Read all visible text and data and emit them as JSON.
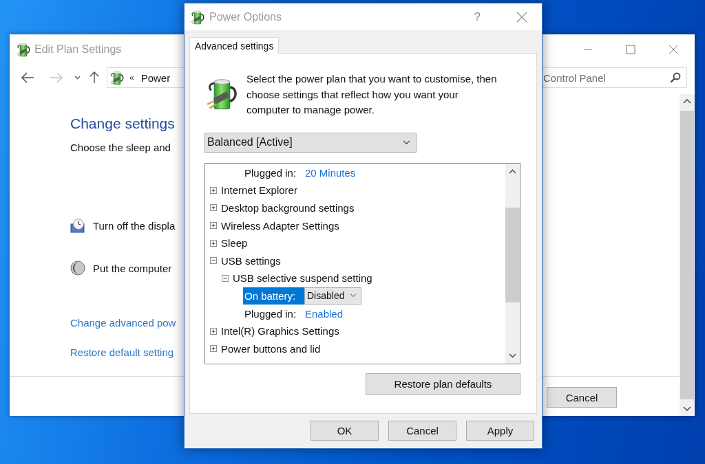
{
  "background_window": {
    "title": "Edit Plan Settings",
    "address": {
      "separator": "«",
      "path": "Power"
    },
    "search": {
      "placeholder": "Control Panel"
    },
    "heading": "Change settings",
    "description": "Choose the sleep and",
    "options": [
      {
        "kind": "display",
        "label": "Turn off the displa"
      },
      {
        "kind": "sleep",
        "label": "Put the computer"
      }
    ],
    "links": [
      "Change advanced pow",
      "Restore default setting"
    ],
    "buttons": [
      "Cancel"
    ]
  },
  "dialog": {
    "title": "Power Options",
    "help_button": "?",
    "tabs": [
      {
        "label": "Advanced settings",
        "selected": true
      }
    ],
    "intro": "Select the power plan that you want to customise, then choose settings that reflect how you want your computer to manage power.",
    "plan": {
      "value": "Balanced [Active]"
    },
    "tree": {
      "continued_setting": {
        "label": "Plugged in:",
        "value": "20 Minutes",
        "selected": false
      },
      "items": [
        {
          "kind": "group",
          "label": "Internet Explorer",
          "expanded": false
        },
        {
          "kind": "group",
          "label": "Desktop background settings",
          "expanded": false
        },
        {
          "kind": "group",
          "label": "Wireless Adapter Settings",
          "expanded": false
        },
        {
          "kind": "group",
          "label": "Sleep",
          "expanded": false
        },
        {
          "kind": "group",
          "label": "USB settings",
          "expanded": true,
          "children": [
            {
              "kind": "group",
              "label": "USB selective suspend setting",
              "expanded": true,
              "children": [
                {
                  "kind": "setting",
                  "label": "On battery:",
                  "value": "Disabled",
                  "selected": true
                },
                {
                  "kind": "setting",
                  "label": "Plugged in:",
                  "value": "Enabled",
                  "selected": false
                }
              ]
            }
          ]
        },
        {
          "kind": "group",
          "label": "Intel(R) Graphics Settings",
          "expanded": false
        },
        {
          "kind": "group",
          "label": "Power buttons and lid",
          "expanded": false
        }
      ]
    },
    "restore_button": "Restore plan defaults",
    "buttons": [
      "OK",
      "Cancel",
      "Apply"
    ]
  }
}
